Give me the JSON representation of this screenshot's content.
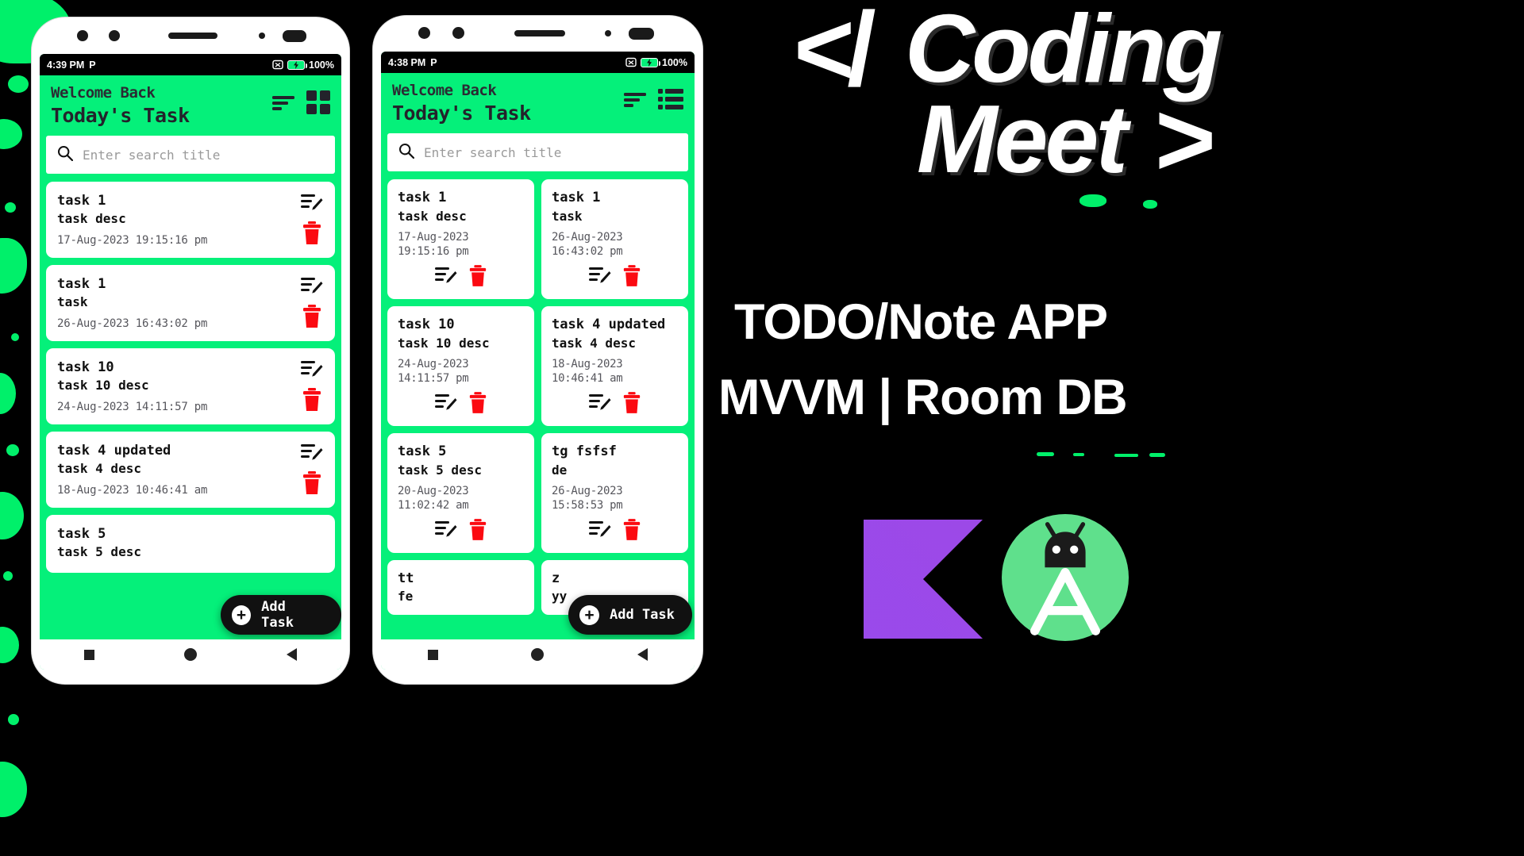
{
  "phones": [
    {
      "id": "phone-list-view",
      "status": {
        "time": "4:39 PM",
        "carrier_glyph": "P",
        "battery": "100%"
      },
      "header": {
        "welcome": "Welcome Back",
        "title": "Today's Task"
      },
      "search": {
        "placeholder": "Enter search title",
        "icon": "search-icon"
      },
      "view_mode_icon": "grid-view-icon",
      "sort_icon": "sort-icon",
      "tasks": [
        {
          "title": "task 1",
          "desc": "task desc",
          "date": "17-Aug-2023 19:15:16 pm"
        },
        {
          "title": "task 1",
          "desc": "task",
          "date": "26-Aug-2023 16:43:02 pm"
        },
        {
          "title": "task 10",
          "desc": "task 10 desc",
          "date": "24-Aug-2023 14:11:57 pm"
        },
        {
          "title": "task 4 updated",
          "desc": "task 4 desc",
          "date": "18-Aug-2023 10:46:41 am"
        },
        {
          "title": "task 5",
          "desc": "task 5 desc",
          "date": ""
        }
      ],
      "fab": {
        "label": "Add Task",
        "icon": "plus-icon"
      }
    },
    {
      "id": "phone-grid-view",
      "status": {
        "time": "4:38 PM",
        "carrier_glyph": "P",
        "battery": "100%"
      },
      "header": {
        "welcome": "Welcome Back",
        "title": "Today's Task"
      },
      "search": {
        "placeholder": "Enter search title",
        "icon": "search-icon"
      },
      "view_mode_icon": "list-view-icon",
      "sort_icon": "sort-icon",
      "tasks": [
        {
          "title": "task 1",
          "desc": "task desc",
          "date1": "17-Aug-2023",
          "date2": "19:15:16 pm"
        },
        {
          "title": "task 1",
          "desc": "task",
          "date1": "26-Aug-2023",
          "date2": "16:43:02 pm"
        },
        {
          "title": "task 10",
          "desc": "task 10 desc",
          "date1": "24-Aug-2023",
          "date2": "14:11:57 pm"
        },
        {
          "title": "task 4 updated",
          "desc": "task 4 desc",
          "date1": "18-Aug-2023",
          "date2": "10:46:41 am"
        },
        {
          "title": "task 5",
          "desc": "task 5 desc",
          "date1": "20-Aug-2023",
          "date2": "11:02:42 am"
        },
        {
          "title": "tg fsfsf",
          "desc": "de",
          "date1": "26-Aug-2023",
          "date2": "15:58:53 pm"
        },
        {
          "title": "tt",
          "desc": "fe",
          "date1": "",
          "date2": ""
        },
        {
          "title": "z",
          "desc": "yy",
          "date1": "",
          "date2": ""
        }
      ],
      "fab": {
        "label": "Add Task",
        "icon": "plus-icon"
      }
    }
  ],
  "branding": {
    "logo_open": "</",
    "logo_word1": "Coding",
    "logo_word2": "Meet",
    "logo_close": ">",
    "headline_line1": "TODO/Note APP",
    "headline_line2": "MVVM | Room DB",
    "kotlin_logo": "kotlin-logo",
    "android_studio_logo": "android-studio-logo"
  },
  "colors": {
    "accent_green": "#05f07a",
    "delete_red": "#fb0a11",
    "dark": "#111111",
    "background": "#000000"
  },
  "nav": {
    "recents": "square-icon",
    "home": "circle-icon",
    "back": "triangle-back-icon"
  }
}
